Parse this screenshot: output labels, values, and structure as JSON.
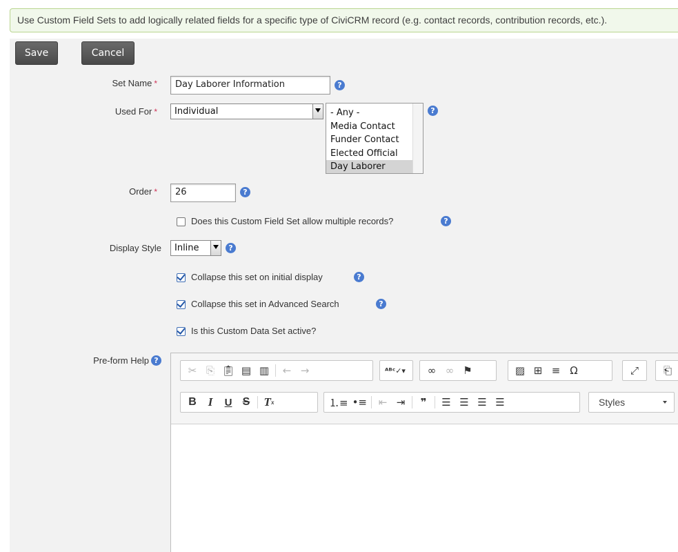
{
  "banner": {
    "text": "Use Custom Field Sets to add logically related fields for a specific type of CiviCRM record (e.g. contact records, contribution records, etc.)."
  },
  "buttons": {
    "save": "Save",
    "cancel": "Cancel"
  },
  "form": {
    "set_name": {
      "label": "Set Name",
      "required_mark": "*",
      "value": "Day Laborer Information"
    },
    "used_for": {
      "label": "Used For",
      "required_mark": "*",
      "selected": "Individual",
      "subtypes": [
        "- Any -",
        "Media Contact",
        "Funder Contact",
        "Elected Official",
        "Day Laborer"
      ],
      "selected_subtype": "Day Laborer"
    },
    "order": {
      "label": "Order",
      "required_mark": "*",
      "value": "26"
    },
    "multiple_records": {
      "label": "Does this Custom Field Set allow multiple records?",
      "checked": false
    },
    "display_style": {
      "label": "Display Style",
      "selected": "Inline"
    },
    "collapse_display": {
      "label": "Collapse this set on initial display",
      "checked": true
    },
    "collapse_search": {
      "label": "Collapse this set in Advanced Search",
      "checked": true
    },
    "is_active": {
      "label": "Is this Custom Data Set active?",
      "checked": true
    },
    "pre_form_help": {
      "label": "Pre-form Help"
    }
  },
  "editor": {
    "row1": [
      "cut-icon",
      "copy-icon",
      "paste-icon",
      "paste-text-icon",
      "paste-word-icon",
      "undo-icon",
      "redo-icon",
      "spellcheck-icon",
      "link-icon",
      "unlink-icon",
      "anchor-icon",
      "image-icon",
      "table-icon",
      "horizontal-rule-icon",
      "special-char-icon",
      "maximize-icon",
      "source-icon"
    ],
    "row2": [
      "bold-icon",
      "italic-icon",
      "underline-icon",
      "strikethrough-icon",
      "remove-format-icon",
      "numbered-list-icon",
      "bulleted-list-icon",
      "decrease-indent-icon",
      "increase-indent-icon",
      "blockquote-icon",
      "align-left-icon",
      "align-center-icon",
      "align-right-icon",
      "justify-icon"
    ],
    "styles_label": "Styles"
  },
  "icons": {
    "help": "?"
  },
  "colors": {
    "banner_bg": "#f1f8eb",
    "banner_border": "#b9d58f",
    "button_bg": "#5a5a5a",
    "required": "#cf3458",
    "help_icon": "#4a7bd0",
    "form_bg": "#f2f2f2"
  }
}
